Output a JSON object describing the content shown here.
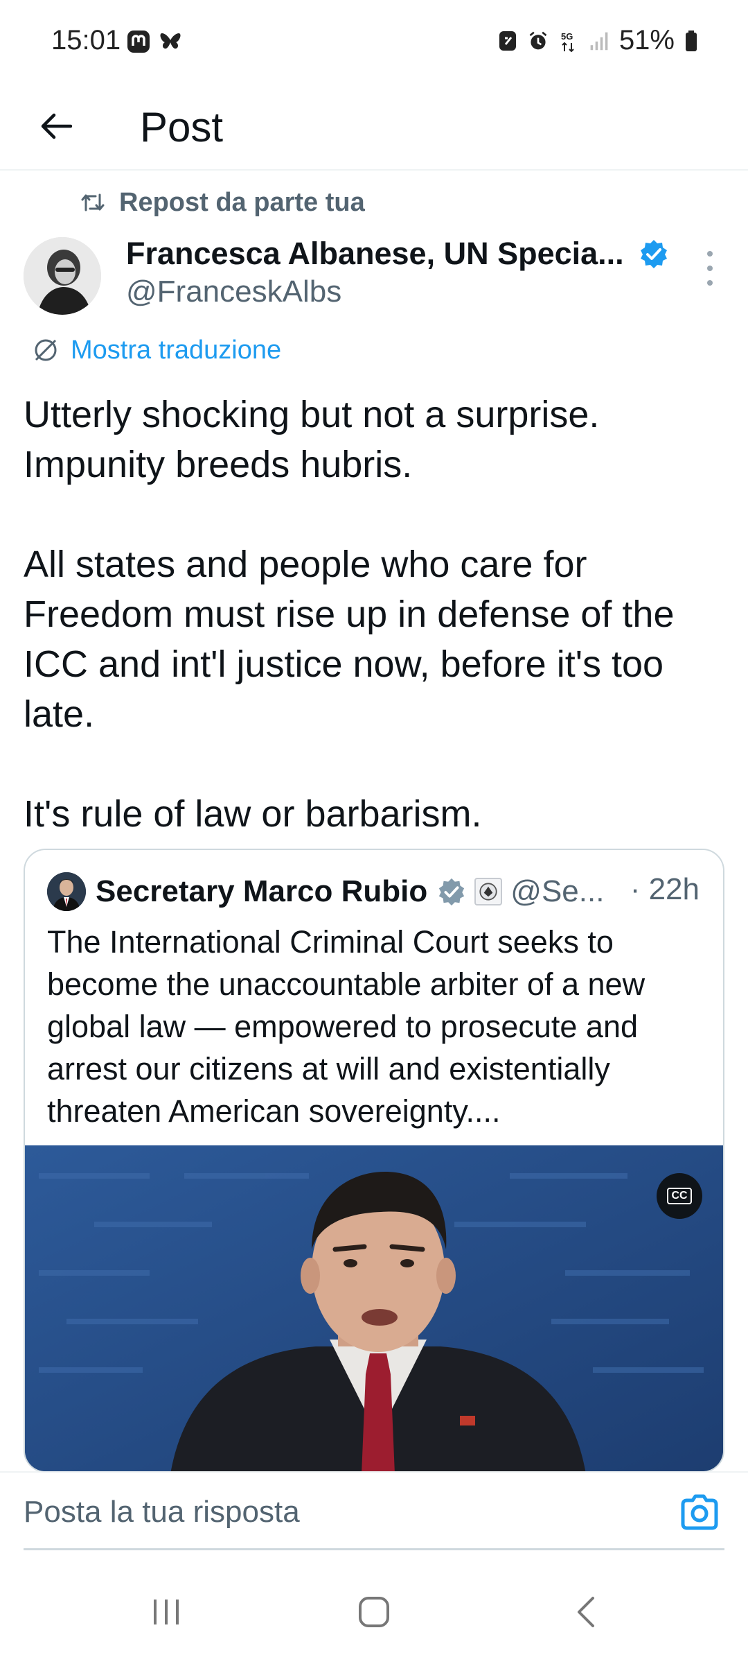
{
  "status_bar": {
    "time": "15:01",
    "network": "5G",
    "battery": "51%",
    "apps": [
      "mastodon-icon",
      "bluesky-icon"
    ]
  },
  "header": {
    "title": "Post"
  },
  "post": {
    "repost_label": "Repost da parte tua",
    "author_name": "Francesca Albanese, UN Specia...",
    "author_handle": "@FranceskAlbs",
    "translate_label": "Mostra traduzione",
    "text_lines": [
      "Utterly shocking but not a surprise.",
      "Impunity breeds hubris.",
      "All states and people who care for",
      "Freedom must rise up in defense of the",
      "ICC and int'l justice now, before it's too",
      "late.",
      "It's rule of law or barbarism."
    ]
  },
  "quote": {
    "author_name": "Secretary Marco Rubio",
    "author_handle": "@Se...",
    "time": "· 22h",
    "text": "The International Criminal Court seeks to become the unaccountable arbiter of a new global law — empowered to prosecute and arrest our citizens at will and existentially threaten American sovereignty....",
    "cc_label": "CC"
  },
  "reply": {
    "placeholder": "Posta la tua risposta"
  },
  "colors": {
    "accent": "#1d9bf0",
    "text": "#0f1419",
    "secondary": "#536471"
  }
}
